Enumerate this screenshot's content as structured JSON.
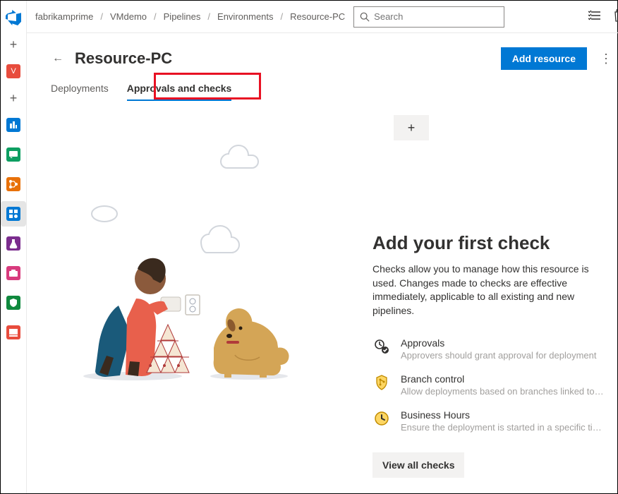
{
  "breadcrumbs": [
    "fabrikamprime",
    "VMdemo",
    "Pipelines",
    "Environments",
    "Resource-PC"
  ],
  "search": {
    "placeholder": "Search"
  },
  "header": {
    "title": "Resource-PC",
    "primary_button": "Add resource"
  },
  "tabs": [
    {
      "label": "Deployments",
      "active": false
    },
    {
      "label": "Approvals and checks",
      "active": true
    }
  ],
  "empty_state": {
    "heading": "Add your first check",
    "description": "Checks allow you to manage how this resource is used. Changes made to checks are effective immediately, applicable to all existing and new pipelines.",
    "view_all": "View all checks"
  },
  "checks": [
    {
      "title": "Approvals",
      "subtitle": "Approvers should grant approval for deployment"
    },
    {
      "title": "Branch control",
      "subtitle": "Allow deployments based on branches linked to the run"
    },
    {
      "title": "Business Hours",
      "subtitle": "Ensure the deployment is started in a specific time win..."
    }
  ],
  "nav_items": [
    {
      "name": "overview",
      "color": "#e84c3d"
    },
    {
      "name": "boards",
      "color": "#0078d4"
    },
    {
      "name": "repos",
      "color": "#10893e"
    },
    {
      "name": "pipelines",
      "color": "#e8710a"
    },
    {
      "name": "pipelines-active",
      "color": "#0078d4",
      "active": true
    },
    {
      "name": "test-plans",
      "color": "#7b2d8e"
    },
    {
      "name": "artifacts",
      "color": "#d83b7d"
    },
    {
      "name": "compliance",
      "color": "#10893e"
    },
    {
      "name": "market",
      "color": "#e84c3d"
    }
  ]
}
